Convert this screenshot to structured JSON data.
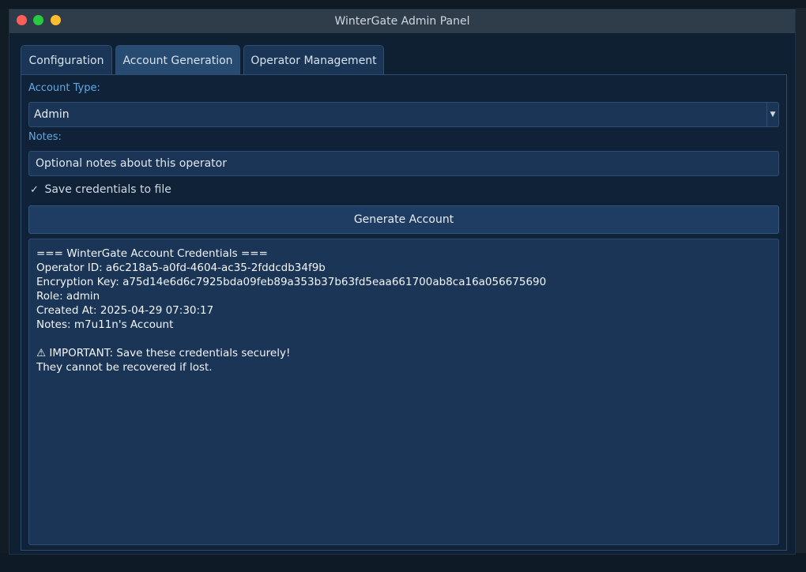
{
  "window": {
    "title": "WinterGate Admin Panel"
  },
  "tabs": [
    {
      "label": "Configuration"
    },
    {
      "label": "Account Generation"
    },
    {
      "label": "Operator Management"
    }
  ],
  "form": {
    "account_type_label": "Account Type:",
    "account_type_value": "Admin",
    "notes_label": "Notes:",
    "notes_placeholder": "Optional notes about this operator",
    "save_checkbox_label": "Save credentials to file",
    "save_checked": true,
    "generate_button_label": "Generate Account"
  },
  "output": {
    "lines": [
      "=== WinterGate Account Credentials ===",
      "Operator ID: a6c218a5-a0fd-4604-ac35-2fddcdb34f9b",
      "Encryption Key: a75d14e6d6c7925bda09feb89a353b37b63fd5eaa661700ab8ca16a056675690",
      "Role: admin",
      "Created At: 2025-04-29 07:30:17",
      "Notes: m7u11n's Account",
      "",
      "⚠ IMPORTANT: Save these credentials securely!",
      "They cannot be recovered if lost."
    ]
  },
  "colors": {
    "accent_label": "#63a8e6",
    "panel_bg": "#102238",
    "field_bg": "#1b3556",
    "active_tab": "#284b72"
  }
}
